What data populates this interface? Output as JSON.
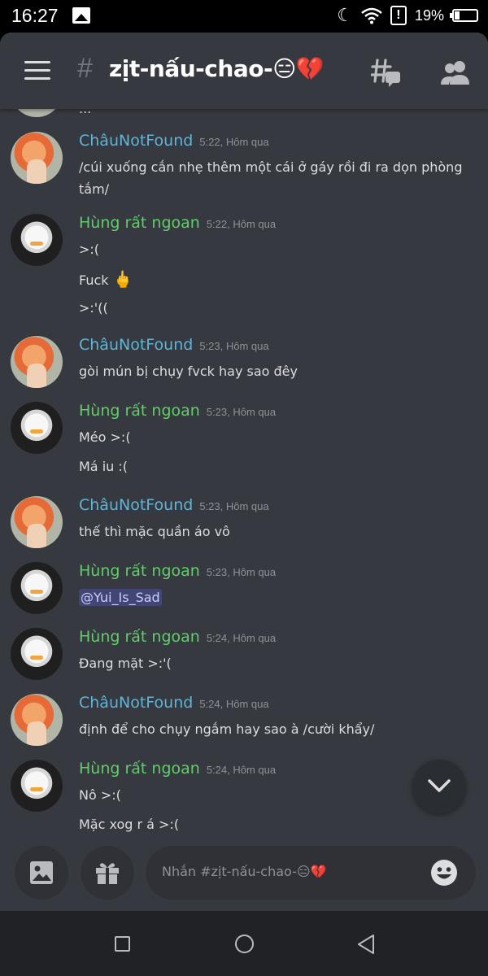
{
  "status_bar": {
    "time": "16:27",
    "battery": "19%"
  },
  "header": {
    "hash": "#",
    "channel_name": "zịt-nấu-chao-😑💔"
  },
  "partial_message": {
    "text": "..."
  },
  "messages": [
    {
      "author": "ChâuNotFound",
      "author_type": "chau",
      "time": "5:22, Hôm qua",
      "lines": [
        "/cúi xuống cắn nhẹ thêm một cái ở gáy rồi đi ra dọn phòng",
        "tắm/"
      ]
    },
    {
      "author": "Hùng rất ngoan",
      "author_type": "hung",
      "time": "5:22, Hôm qua",
      "lines": [
        ">:(",
        "Fuck",
        ">:'(("
      ],
      "emoji": "🖕"
    },
    {
      "author": "ChâuNotFound",
      "author_type": "chau",
      "time": "5:23, Hôm qua",
      "lines": [
        "gòi mún bị chụy fvck hay sao đêy"
      ]
    },
    {
      "author": "Hùng rất ngoan",
      "author_type": "hung",
      "time": "5:23, Hôm qua",
      "lines": [
        "Méo >:(",
        "Má iu :("
      ]
    },
    {
      "author": "ChâuNotFound",
      "author_type": "chau",
      "time": "5:23, Hôm qua",
      "lines": [
        "thế thì mặc quần áo vô"
      ]
    },
    {
      "author": "Hùng rất ngoan",
      "author_type": "hung",
      "time": "5:23, Hôm qua",
      "lines": [
        "@Yui_Is_Sad"
      ]
    },
    {
      "author": "Hùng rất ngoan",
      "author_type": "hung",
      "time": "5:24, Hôm qua",
      "lines": [
        "Đang mặt >:'("
      ]
    },
    {
      "author": "ChâuNotFound",
      "author_type": "chau",
      "time": "5:24, Hôm qua",
      "lines": [
        "định để cho chụy ngắm hay sao à /cười khẩy/"
      ]
    },
    {
      "author": "Hùng rất ngoan",
      "author_type": "hung",
      "time": "5:24, Hôm qua",
      "lines": [
        "Nô >:(",
        "Mặc xog r á >:("
      ]
    }
  ],
  "composer": {
    "placeholder": "Nhắn #zịt-nấu-chao-😑💔"
  },
  "icons": [
    "hamburger-icon",
    "threads-icon",
    "members-icon",
    "image-icon",
    "gift-icon",
    "emoji-icon",
    "chevron-down-icon"
  ],
  "colors": {
    "background": "#36393f",
    "chau_name": "#5fb5d8",
    "hung_name": "#63cc6b",
    "mention_bg": "#414675"
  }
}
